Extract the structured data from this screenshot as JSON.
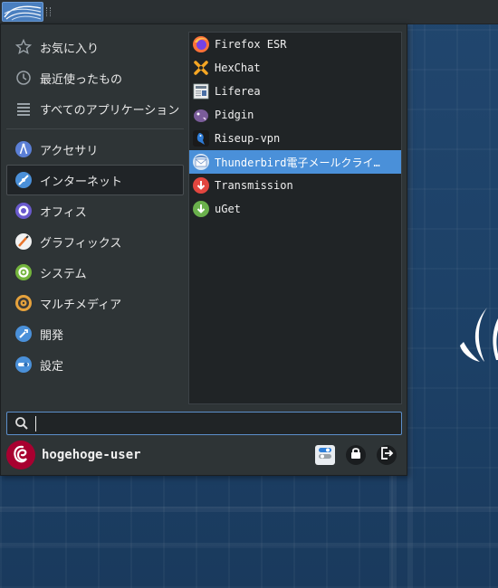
{
  "panel": {
    "launcher_icon": "xfce-menu-icon",
    "handle_icon": "panel-handle-icon"
  },
  "sidebar": {
    "top": [
      {
        "label": "お気に入り",
        "icon": "star-icon"
      },
      {
        "label": "最近使ったもの",
        "icon": "clock-icon"
      },
      {
        "label": "すべてのアプリケーション",
        "icon": "list-icon"
      }
    ],
    "categories": [
      {
        "label": "アクセサリ",
        "icon": "accessories-icon"
      },
      {
        "label": "インターネット",
        "icon": "internet-icon",
        "selected": true
      },
      {
        "label": "オフィス",
        "icon": "office-icon"
      },
      {
        "label": "グラフィックス",
        "icon": "graphics-icon"
      },
      {
        "label": "システム",
        "icon": "system-icon"
      },
      {
        "label": "マルチメディア",
        "icon": "multimedia-icon"
      },
      {
        "label": "開発",
        "icon": "development-icon"
      },
      {
        "label": "設定",
        "icon": "settings-icon"
      }
    ]
  },
  "apps": [
    {
      "label": "Firefox ESR",
      "icon": "firefox-icon"
    },
    {
      "label": "HexChat",
      "icon": "hexchat-icon"
    },
    {
      "label": "Liferea",
      "icon": "liferea-icon"
    },
    {
      "label": "Pidgin",
      "icon": "pidgin-icon"
    },
    {
      "label": "Riseup-vpn",
      "icon": "riseup-vpn-icon"
    },
    {
      "label": "Thunderbird電子メールクライ…",
      "icon": "thunderbird-icon",
      "selected": true
    },
    {
      "label": "Transmission",
      "icon": "transmission-icon"
    },
    {
      "label": "uGet",
      "icon": "uget-icon"
    }
  ],
  "search": {
    "value": "",
    "placeholder": ""
  },
  "footer": {
    "username": "hogehoge-user"
  },
  "colors": {
    "accent": "#4a90d9",
    "debian_red": "#a80030"
  }
}
